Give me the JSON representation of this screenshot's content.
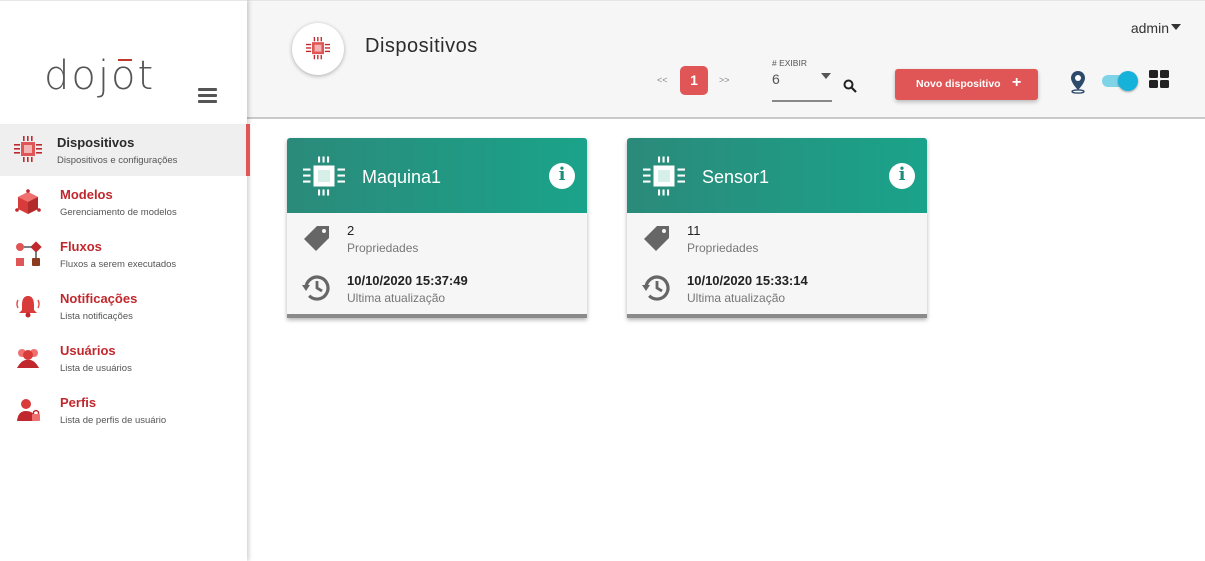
{
  "logo": {
    "text": "dojot"
  },
  "sidebar": {
    "items": [
      {
        "label": "Dispositivos",
        "sub": "Dispositivos e configurações",
        "icon": "chip-icon",
        "active": true
      },
      {
        "label": "Modelos",
        "sub": "Gerenciamento de modelos",
        "icon": "cube-icon"
      },
      {
        "label": "Fluxos",
        "sub": "Fluxos a serem executados",
        "icon": "flow-icon"
      },
      {
        "label": "Notificações",
        "sub": "Lista notificações",
        "icon": "bell-icon"
      },
      {
        "label": "Usuários",
        "sub": "Lista de usuários",
        "icon": "users-icon"
      },
      {
        "label": "Perfis",
        "sub": "Lista de perfis de usuário",
        "icon": "profile-lock-icon"
      }
    ]
  },
  "header": {
    "title": "Dispositivos",
    "user": "admin",
    "pagination": {
      "prev": "<<",
      "current": "1",
      "next": ">>"
    },
    "exibir": {
      "label": "# EXIBIR",
      "value": "6"
    },
    "new_button": "Novo dispositivo",
    "new_button_icon": "+",
    "info_glyph": "i"
  },
  "colors": {
    "accent": "#e05555",
    "card_header_start": "#2b8a7a",
    "card_header_end": "#1aa38a",
    "toggle": "#17b2da"
  },
  "devices": [
    {
      "name": "Maquina1",
      "properties": "2",
      "properties_label": "Propriedades",
      "updated": "10/10/2020 15:37:49",
      "updated_label": "Ultima atualização"
    },
    {
      "name": "Sensor1",
      "properties": "11",
      "properties_label": "Propriedades",
      "updated": "10/10/2020 15:33:14",
      "updated_label": "Ultima atualização"
    }
  ]
}
